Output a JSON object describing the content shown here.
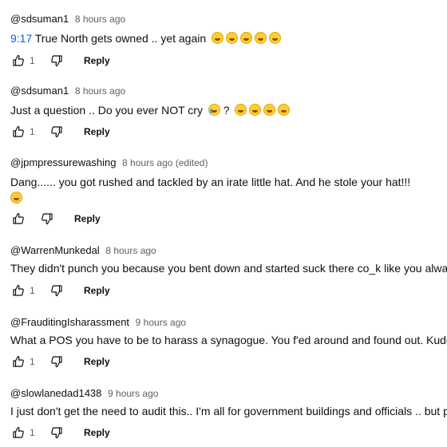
{
  "comments": [
    {
      "author": "@sdsuman1",
      "time": "8 hours ago",
      "timestamp_link": "9:17",
      "text": " True North gets owned .. yet again",
      "emojis": [
        "laugh",
        "laugh",
        "laugh",
        "laugh",
        "laugh"
      ],
      "likes": "1",
      "reply_label": "Reply"
    },
    {
      "author": "@sdsuman1",
      "time": "8 hours ago",
      "text": "Just a question .. Do you ever NOT cry",
      "text_after_cry": " ?",
      "emojis": [
        "laugh",
        "laugh",
        "laugh",
        "laugh"
      ],
      "likes": "1",
      "reply_label": "Reply"
    },
    {
      "author": "@jpmpressurewashing",
      "time": "8 hours ago (edited)",
      "text": "Dang...... you got rushed and tackled by an irate little hat. And he stole your hat!!!",
      "emojis": [
        "laugh"
      ],
      "likes": "",
      "reply_label": "Reply"
    },
    {
      "author": "@WarrenMunkedal",
      "time": "8 hours ago",
      "text": "They didn't punch you because you bent down and started suck there co_k like you always do",
      "likes": "1",
      "reply_label": "Reply"
    },
    {
      "author": "@FrauditingIsharassment",
      "time": "9 hours ago",
      "text": "What a POS you have to be to harass a synagogue.  You f'ed around and found out.  Kudos to",
      "likes": "1",
      "reply_label": "Reply"
    },
    {
      "author": "@slowlanedad1438",
      "time": "9 hours ago",
      "text": "I just don't get the need to audit this.. I'm all for government buildings and officials .. but priva",
      "likes": "1",
      "reply_label": "Reply"
    }
  ],
  "icons": {
    "like": "thumbs-up-icon",
    "dislike": "thumbs-down-icon",
    "emoji_laugh": "laughing-emoji-icon",
    "emoji_cry": "crying-emoji-icon"
  },
  "colors": {
    "link": "#065fd4",
    "secondary_text": "#606060",
    "primary_text": "#0f0f0f"
  }
}
